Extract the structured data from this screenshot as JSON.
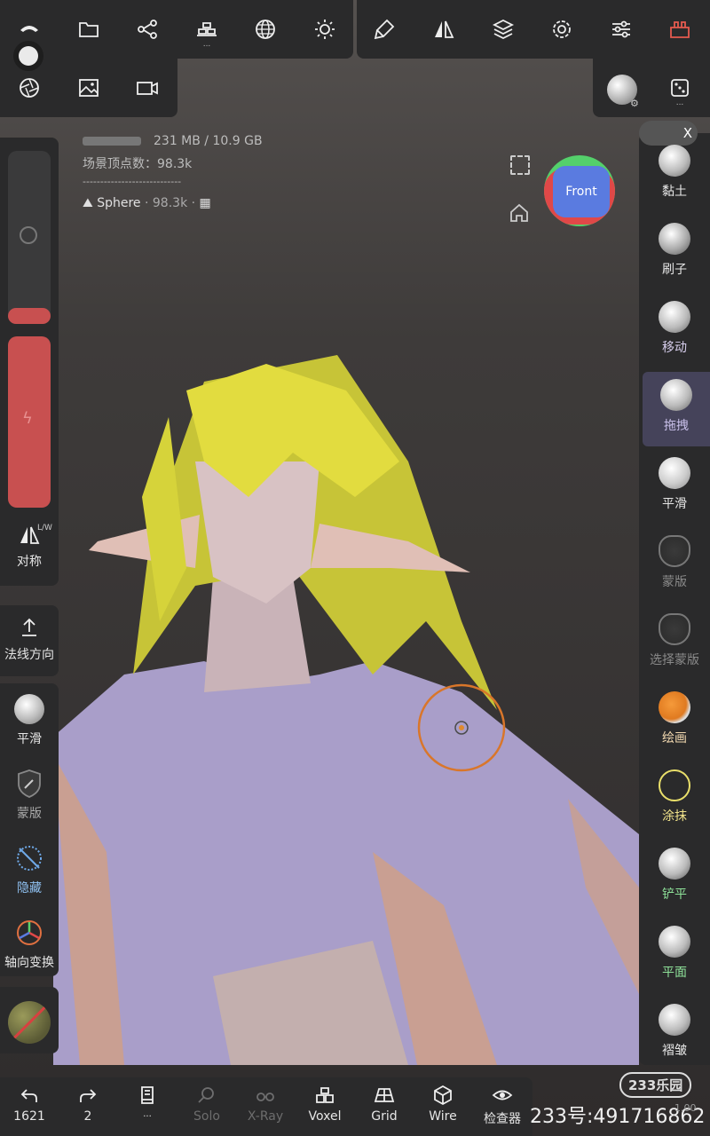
{
  "stats": {
    "memory": "231 MB / 10.9 GB",
    "vertices": "场景顶点数：98.3k",
    "separator": "----------------------------",
    "object_name": "Sphere",
    "object_info": "· 98.3k ·"
  },
  "top_toolbar": {
    "icons": [
      "logo-icon",
      "folder-icon",
      "share-graph-icon",
      "scene-icon",
      "wireframe-sphere-icon",
      "light-icon",
      "brush-pen-icon",
      "symmetry-icon",
      "layers-icon",
      "settings-icon",
      "sliders-icon",
      "toolbox-icon"
    ],
    "row2": [
      "aperture-icon",
      "image-icon",
      "video-icon"
    ],
    "more": "..."
  },
  "gizmo": {
    "face": "Front",
    "colors": {
      "front": "#5a7be0",
      "left": "#e04848",
      "top": "#54d06b"
    }
  },
  "left_panel": {
    "symmetry_label": "对称",
    "symmetry_badge": "L/W",
    "normal_label": "法线方向",
    "tools": [
      {
        "label": "平滑"
      },
      {
        "label": "蒙版"
      },
      {
        "label": "隐藏"
      },
      {
        "label": "轴向变换"
      }
    ]
  },
  "right_panel": {
    "badge_text": "X",
    "tools": [
      {
        "label": "黏土",
        "color": "#e6e6e6"
      },
      {
        "label": "刷子",
        "color": "#e6e6e6"
      },
      {
        "label": "移动",
        "color": "#d8cfee"
      },
      {
        "label": "拖拽",
        "color": "#c9c0ea"
      },
      {
        "label": "平滑",
        "color": "#e6e6e6"
      },
      {
        "label": "蒙版",
        "color": "#8a8a8a"
      },
      {
        "label": "选择蒙版",
        "color": "#8a8a8a"
      },
      {
        "label": "绘画",
        "color": "#f3d9b0"
      },
      {
        "label": "涂抹",
        "color": "#f0e28a"
      },
      {
        "label": "铲平",
        "color": "#8fe39a"
      },
      {
        "label": "平面",
        "color": "#8fe39a"
      },
      {
        "label": "褶皱",
        "color": "#e6e6e6"
      }
    ]
  },
  "bottom_toolbar": {
    "items": [
      {
        "label": "1621",
        "name": "undo"
      },
      {
        "label": "2",
        "name": "redo"
      },
      {
        "label": "...",
        "name": "history"
      },
      {
        "label": "Solo",
        "name": "solo"
      },
      {
        "label": "X-Ray",
        "name": "xray"
      },
      {
        "label": "Voxel",
        "name": "voxel"
      },
      {
        "label": "Grid",
        "name": "grid"
      },
      {
        "label": "Wire",
        "name": "wire"
      },
      {
        "label": "检查器",
        "name": "inspector"
      }
    ]
  },
  "watermark": {
    "brand": "233乐园",
    "id_text": "233号:491716862",
    "corner": "1.00"
  }
}
